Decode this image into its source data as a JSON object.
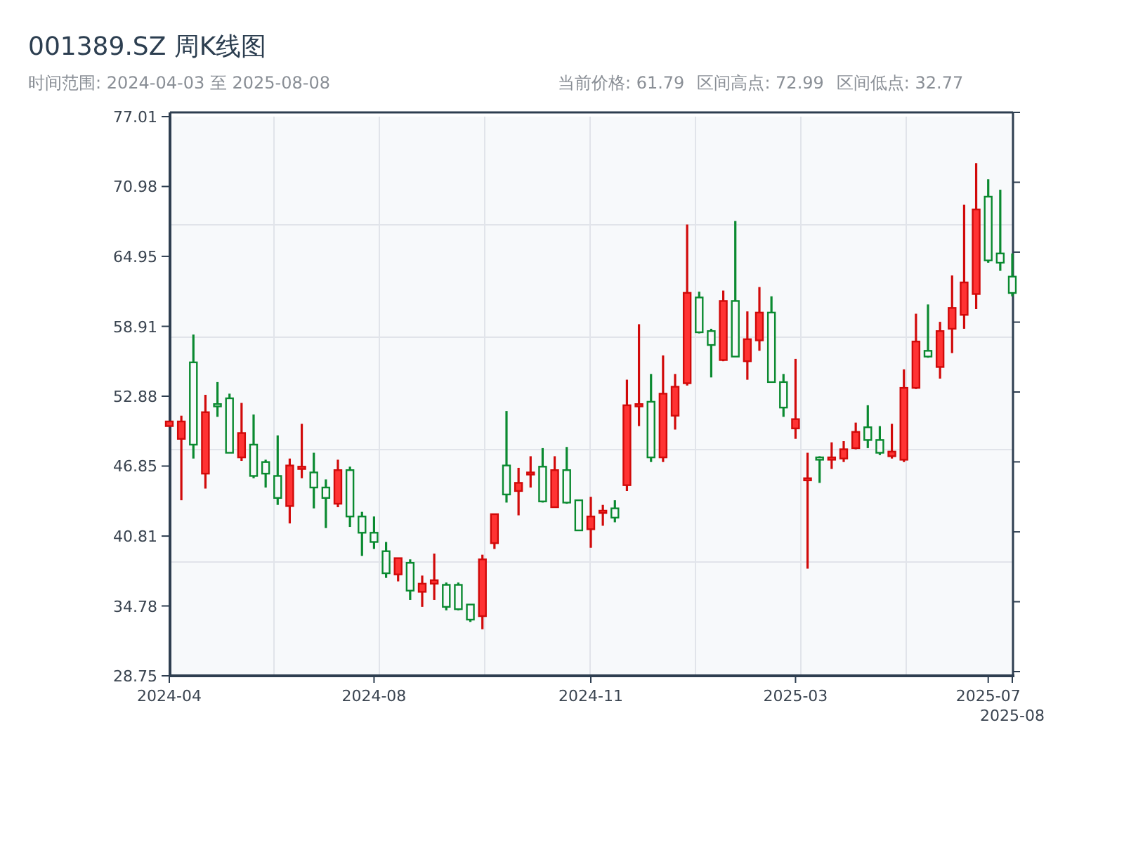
{
  "header": {
    "title": "001389.SZ 周K线图",
    "range": "时间范围: 2024-04-03 至 2025-08-08",
    "stats": [
      "当前价格: 61.79",
      "区间高点: 72.99",
      "区间低点: 32.77"
    ]
  },
  "chart": {
    "chart_data": {
      "type": "candlestick",
      "grid": true,
      "ylim": [
        28.75,
        77.01
      ],
      "yticks": [
        {
          "value": 28.75,
          "label": "28.75"
        },
        {
          "value": 34.78,
          "label": "34.78"
        },
        {
          "value": 40.81,
          "label": "40.81"
        },
        {
          "value": 46.85,
          "label": "46.85"
        },
        {
          "value": 52.88,
          "label": "52.88"
        },
        {
          "value": 58.91,
          "label": "58.91"
        },
        {
          "value": 64.95,
          "label": "64.95"
        },
        {
          "value": 70.98,
          "label": "70.98"
        },
        {
          "value": 77.01,
          "label": "77.01"
        }
      ],
      "categories": [
        "2024-04",
        null,
        null,
        null,
        null,
        null,
        null,
        null,
        null,
        null,
        null,
        null,
        null,
        null,
        null,
        null,
        null,
        "2024-08",
        null,
        null,
        null,
        null,
        null,
        null,
        null,
        null,
        null,
        null,
        null,
        null,
        null,
        null,
        null,
        null,
        null,
        "2024-11",
        null,
        null,
        null,
        null,
        null,
        null,
        null,
        null,
        null,
        null,
        null,
        null,
        null,
        null,
        null,
        null,
        "2025-03",
        null,
        null,
        null,
        null,
        null,
        null,
        null,
        null,
        null,
        null,
        null,
        null,
        null,
        null,
        null,
        "2025-07",
        null,
        "2025-08"
      ],
      "ohlc": [
        [
          50.3,
          50.7,
          50.3,
          50.7
        ],
        [
          49.2,
          51.2,
          43.9,
          50.7
        ],
        [
          55.8,
          58.2,
          47.5,
          48.7
        ],
        [
          46.2,
          53.0,
          44.9,
          51.5
        ],
        [
          52.2,
          54.1,
          51.1,
          52.0
        ],
        [
          52.7,
          53.1,
          48.0,
          48.0
        ],
        [
          47.6,
          52.3,
          47.3,
          49.7
        ],
        [
          48.7,
          51.3,
          45.8,
          46.0
        ],
        [
          47.2,
          47.4,
          45.0,
          46.2
        ],
        [
          46.0,
          49.5,
          43.5,
          44.1
        ],
        [
          43.4,
          47.5,
          41.9,
          46.9
        ],
        [
          46.6,
          50.5,
          45.8,
          46.8
        ],
        [
          46.3,
          48.0,
          43.2,
          45.0
        ],
        [
          45.0,
          45.7,
          41.5,
          44.1
        ],
        [
          43.6,
          47.4,
          43.3,
          46.5
        ],
        [
          46.5,
          46.8,
          41.6,
          42.5
        ],
        [
          42.5,
          42.9,
          39.1,
          41.1
        ],
        [
          41.1,
          42.5,
          39.7,
          40.3
        ],
        [
          39.5,
          40.3,
          37.2,
          37.6
        ],
        [
          37.5,
          38.9,
          36.9,
          38.9
        ],
        [
          38.5,
          38.8,
          35.3,
          36.1
        ],
        [
          36.0,
          37.4,
          34.7,
          36.7
        ],
        [
          36.7,
          39.3,
          35.3,
          37.0
        ],
        [
          36.6,
          36.8,
          34.4,
          34.7
        ],
        [
          36.6,
          36.8,
          34.4,
          34.5
        ],
        [
          34.9,
          34.9,
          33.4,
          33.6
        ],
        [
          33.9,
          39.2,
          32.77,
          38.8
        ],
        [
          40.2,
          42.7,
          39.7,
          42.7
        ],
        [
          46.9,
          51.6,
          43.7,
          44.4
        ],
        [
          44.7,
          46.7,
          42.6,
          45.4
        ],
        [
          46.2,
          47.7,
          45.0,
          46.3
        ],
        [
          46.8,
          48.4,
          43.7,
          43.8
        ],
        [
          43.3,
          47.7,
          43.3,
          46.5
        ],
        [
          46.5,
          48.5,
          43.6,
          43.7
        ],
        [
          43.9,
          43.9,
          41.3,
          41.3
        ],
        [
          41.4,
          44.2,
          39.8,
          42.5
        ],
        [
          42.8,
          43.5,
          41.7,
          43.0
        ],
        [
          43.2,
          43.9,
          42.0,
          42.4
        ],
        [
          45.2,
          54.3,
          44.7,
          52.1
        ],
        [
          52.0,
          59.1,
          50.3,
          52.2
        ],
        [
          52.4,
          54.8,
          47.2,
          47.6
        ],
        [
          47.6,
          56.4,
          47.2,
          53.1
        ],
        [
          51.2,
          54.8,
          50.0,
          53.7
        ],
        [
          54.0,
          67.7,
          53.8,
          61.8
        ],
        [
          61.4,
          61.9,
          58.3,
          58.4
        ],
        [
          58.5,
          58.7,
          54.5,
          57.3
        ],
        [
          56.0,
          62.0,
          55.9,
          61.1
        ],
        [
          61.1,
          68.0,
          56.3,
          56.3
        ],
        [
          55.9,
          60.2,
          54.3,
          57.8
        ],
        [
          57.7,
          62.3,
          56.8,
          60.1
        ],
        [
          60.1,
          61.5,
          54.1,
          54.1
        ],
        [
          54.1,
          54.8,
          51.1,
          51.9
        ],
        [
          50.1,
          56.1,
          49.2,
          50.9
        ],
        [
          45.7,
          48.0,
          38.0,
          45.8
        ],
        [
          47.6,
          47.7,
          45.4,
          47.4
        ],
        [
          47.4,
          48.9,
          46.6,
          47.6
        ],
        [
          47.5,
          49.0,
          47.2,
          48.3
        ],
        [
          48.4,
          50.6,
          48.3,
          49.8
        ],
        [
          50.2,
          52.1,
          48.4,
          49.1
        ],
        [
          49.1,
          50.3,
          47.8,
          48.0
        ],
        [
          47.7,
          50.5,
          47.5,
          48.1
        ],
        [
          47.4,
          55.2,
          47.2,
          53.6
        ],
        [
          53.6,
          60.0,
          53.5,
          57.6
        ],
        [
          56.8,
          60.8,
          56.2,
          56.3
        ],
        [
          55.4,
          59.3,
          54.4,
          58.5
        ],
        [
          58.7,
          63.3,
          56.6,
          60.5
        ],
        [
          59.9,
          69.4,
          58.7,
          62.7
        ],
        [
          61.7,
          72.99,
          60.4,
          69.0
        ],
        [
          70.1,
          71.6,
          64.4,
          64.6
        ],
        [
          65.2,
          70.7,
          63.7,
          64.4
        ],
        [
          63.2,
          65.2,
          61.5,
          61.79
        ]
      ]
    }
  }
}
